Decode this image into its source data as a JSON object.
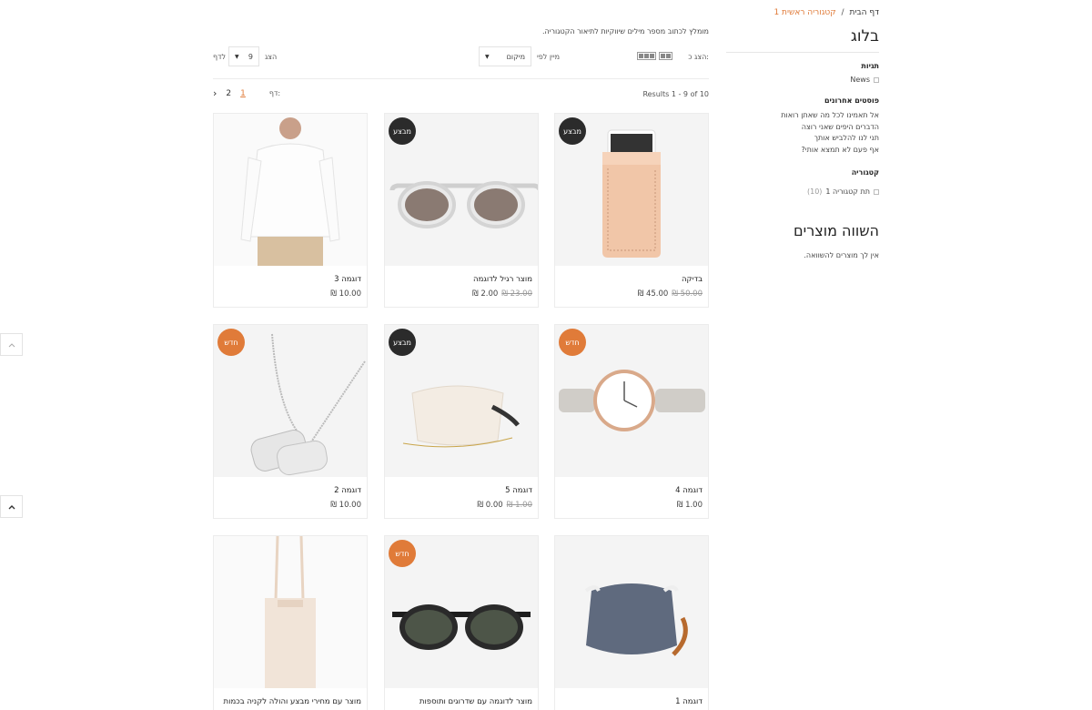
{
  "breadcrumb": {
    "home": "דף הבית",
    "separator": "/",
    "current": "קטגוריה ראשית 1"
  },
  "sidebar": {
    "blog_title": "בלוג",
    "tags_heading": "תגיות",
    "tags": [
      {
        "label": "News"
      }
    ],
    "recent_heading": "פוסטים אחרונים",
    "recent_posts": [
      "אל תאמינו לכל מה שאתן רואות",
      "הדברים היפים שאני רוצה",
      "תני לנו להלביש אותך",
      "אף פעם לא תמצא אותי?"
    ],
    "category_heading": "קטגוריה",
    "categories": [
      {
        "label": "תת קטגוריה 1",
        "count": "(10)"
      }
    ],
    "compare_title": "השווה מוצרים",
    "compare_empty": "אין לך מוצרים להשוואה."
  },
  "main": {
    "category_description": "מומלץ לכתוב מספר מילים שיווקיות לתיאור הקטגוריה.",
    "toolbar": {
      "view_label": "הצג כ:",
      "sort_label": "מיין לפי",
      "sort_value": "מיקום",
      "show_label": "הצג",
      "per_page_value": "9",
      "per_page_suffix": "לדף"
    },
    "results_text": "Results 1 - 9 of 10",
    "pager": {
      "label": "דף:",
      "pages": [
        "1",
        "2"
      ],
      "next": "›"
    }
  },
  "products": [
    {
      "name": "בדיקה",
      "price": "45.00 ₪",
      "old_price": "50.00 ₪",
      "badge": "מבצע",
      "badge_type": "sale",
      "image": "leather-phone-sleeve"
    },
    {
      "name": "מוצר רגיל לדוגמה",
      "price": "2.00 ₪",
      "old_price": "23.00 ₪",
      "badge": "מבצע",
      "badge_type": "sale",
      "image": "clear-sunglasses"
    },
    {
      "name": "דוגמה 3",
      "price": "10.00 ₪",
      "old_price": "",
      "badge": "",
      "badge_type": "",
      "image": "white-shirt-model"
    },
    {
      "name": "דוגמה 4",
      "price": "1.00 ₪",
      "old_price": "",
      "badge": "חדש",
      "badge_type": "new",
      "image": "watch"
    },
    {
      "name": "דוגמה 5",
      "price": "0.00 ₪",
      "old_price": "1.00 ₪",
      "badge": "מבצע",
      "badge_type": "sale",
      "image": "fur-clutch"
    },
    {
      "name": "דוגמה 2",
      "price": "10.00 ₪",
      "old_price": "",
      "badge": "חדש",
      "badge_type": "new",
      "image": "dog-tag-necklace"
    },
    {
      "name": "דוגמה 1",
      "price": "",
      "old_price": "",
      "badge": "",
      "badge_type": "",
      "image": "denim-pouch"
    },
    {
      "name": "מוצר לדוגמה עם שדרוגים ותוספות",
      "price": "",
      "old_price": "",
      "badge": "חדש",
      "badge_type": "new",
      "image": "dark-sunglasses"
    },
    {
      "name": "מוצר עם מחירי מבצע והולה לקניה בכמות",
      "price": "",
      "old_price": "",
      "badge": "",
      "badge_type": "",
      "image": "canvas-tote"
    }
  ],
  "icons": {
    "scroll_up": "chevron-up-icon"
  },
  "colors": {
    "accent": "#e07b39",
    "sale_badge": "#2b2b2b"
  }
}
